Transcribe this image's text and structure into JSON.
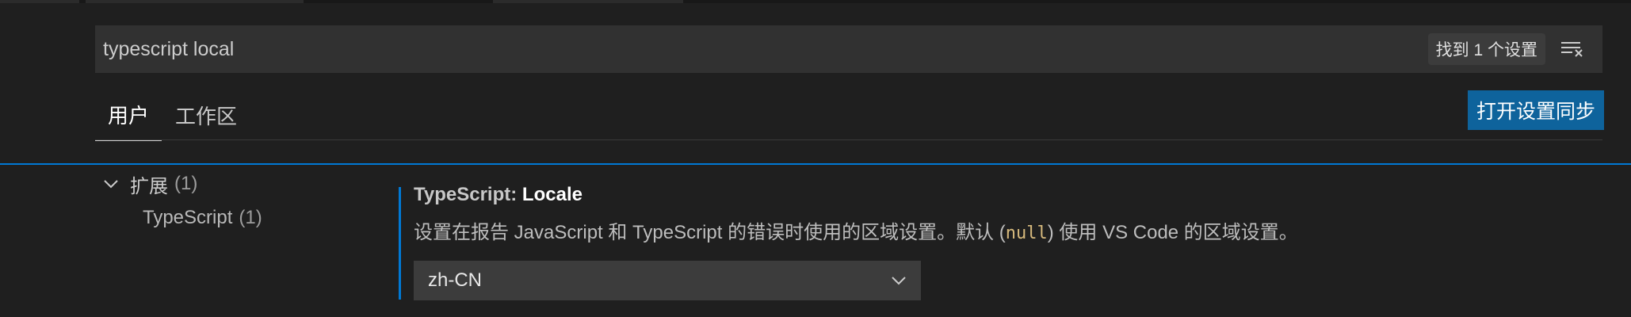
{
  "search": {
    "value": "typescript local",
    "result_count": "找到 1 个设置"
  },
  "tabs": [
    {
      "label": "用户"
    },
    {
      "label": "工作区"
    }
  ],
  "sync_button_label": "打开设置同步",
  "toc": {
    "group_label": "扩展",
    "group_count": "(1)",
    "child_label": "TypeScript",
    "child_count": "(1)"
  },
  "setting": {
    "category": "TypeScript: ",
    "label": "Locale",
    "description_pre": "设置在报告 JavaScript 和 TypeScript 的错误时使用的区域设置。默认 (",
    "description_code": "null",
    "description_post": ") 使用 VS Code 的区域设置。",
    "value": "zh-CN"
  },
  "icons": {
    "clear_filter": "clear-filter-icon",
    "chevron_group": "chevron-down-icon",
    "chevron_select": "chevron-down-icon"
  },
  "colors": {
    "accent": "#0078d4",
    "button": "#0e639c",
    "background": "#1f1f1f",
    "input_background": "#313131",
    "code_null": "#d7ba7d"
  }
}
